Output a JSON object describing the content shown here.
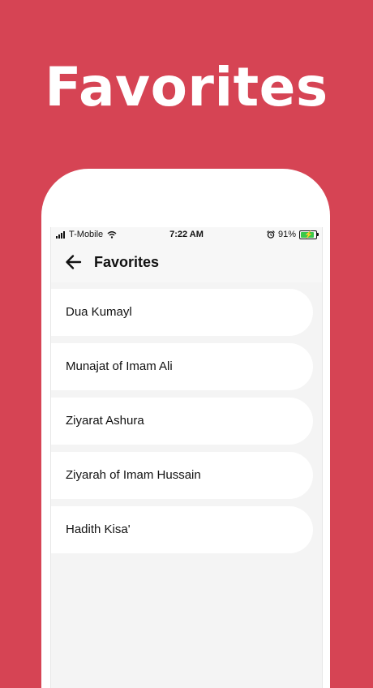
{
  "hero": {
    "title": "Favorites"
  },
  "status_bar": {
    "carrier": "T-Mobile",
    "time": "7:22 AM",
    "battery_percent": "91%",
    "battery_level": 0.91
  },
  "header": {
    "title": "Favorites"
  },
  "favorites": [
    {
      "label": "Dua Kumayl"
    },
    {
      "label": "Munajat of Imam Ali"
    },
    {
      "label": "Ziyarat Ashura"
    },
    {
      "label": "Ziyarah of Imam Hussain"
    },
    {
      "label": "Hadith Kisa'"
    }
  ],
  "colors": {
    "background": "#d64454",
    "battery_charging": "#39c84a"
  }
}
